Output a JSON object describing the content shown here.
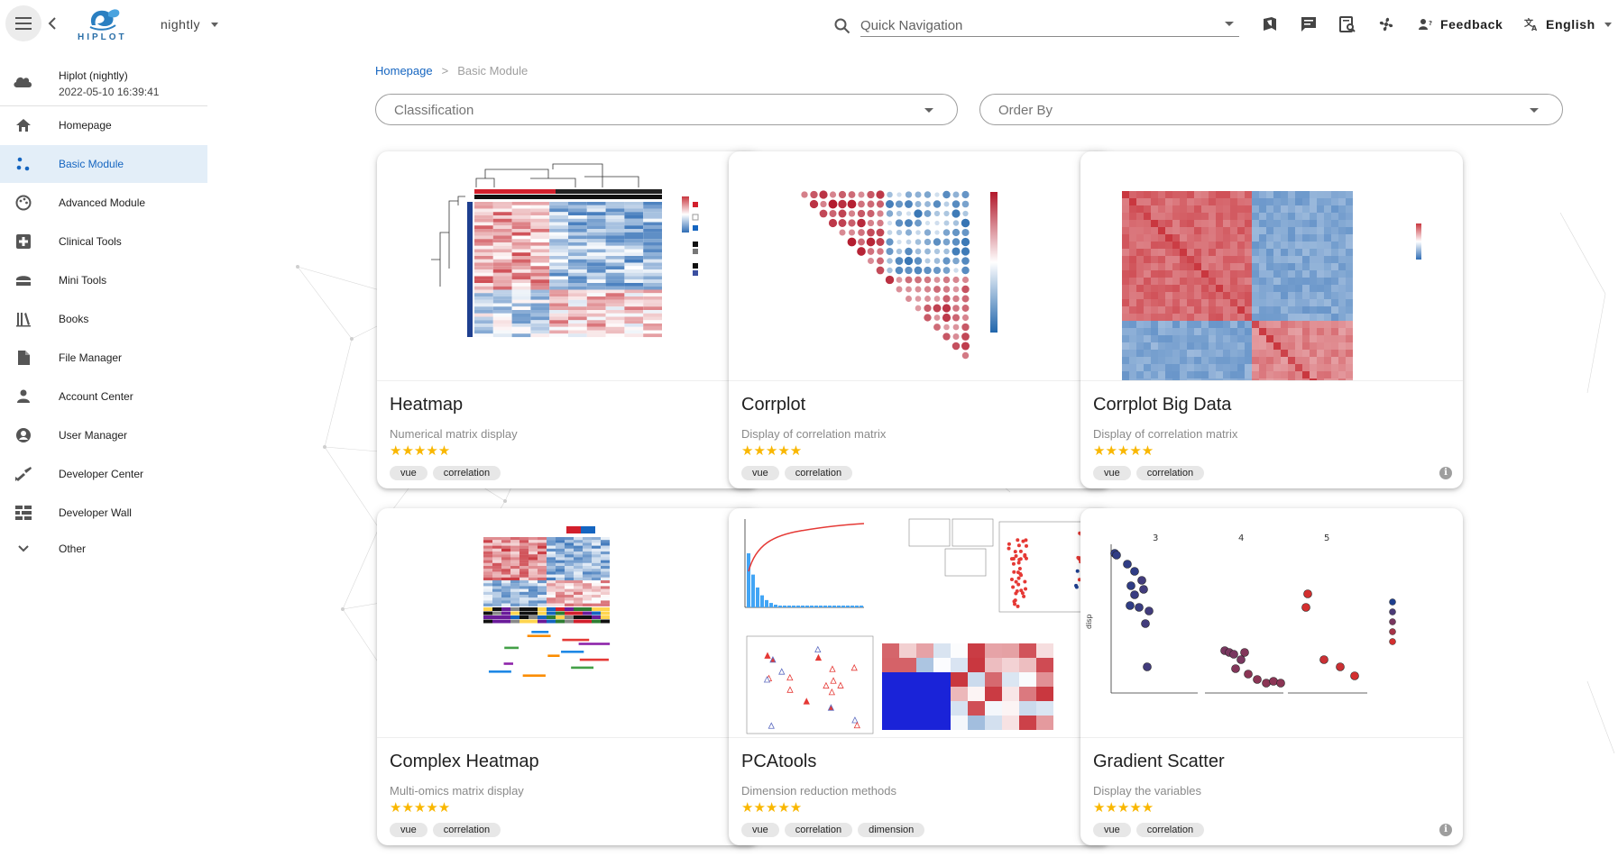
{
  "topbar": {
    "logo_text": "HIPLOT",
    "branch": "nightly",
    "search_placeholder": "Quick Navigation",
    "feedback_label": "Feedback",
    "language_label": "English",
    "icons": [
      "bookmark-icon",
      "chat-icon",
      "doc-search-icon",
      "fan-icon"
    ]
  },
  "sidebar": {
    "status": {
      "name": "Hiplot (nightly)",
      "timestamp": "2022-05-10 16:39:41"
    },
    "items": [
      {
        "label": "Homepage",
        "icon": "home-icon"
      },
      {
        "label": "Basic Module",
        "icon": "scatter-dots-icon",
        "active": true
      },
      {
        "label": "Advanced Module",
        "icon": "palette-icon"
      },
      {
        "label": "Clinical Tools",
        "icon": "medical-cross-icon"
      },
      {
        "label": "Mini Tools",
        "icon": "toolbox-icon"
      },
      {
        "label": "Books",
        "icon": "books-icon"
      },
      {
        "label": "File Manager",
        "icon": "file-icon"
      },
      {
        "label": "Account Center",
        "icon": "person-icon"
      },
      {
        "label": "User Manager",
        "icon": "account-circle-icon"
      },
      {
        "label": "Developer Center",
        "icon": "developer-icon"
      },
      {
        "label": "Developer Wall",
        "icon": "grid-wall-icon"
      },
      {
        "label": "Other",
        "icon": "chevron-down-icon"
      }
    ]
  },
  "breadcrumb": {
    "home": "Homepage",
    "separator": ">",
    "current": "Basic Module"
  },
  "filters": {
    "classification": "Classification",
    "order_by": "Order By"
  },
  "cards": [
    {
      "title": "Heatmap",
      "description": "Numerical matrix display",
      "stars": "★★★★★",
      "tags": [
        "vue",
        "correlation"
      ]
    },
    {
      "title": "Corrplot",
      "description": "Display of correlation matrix",
      "stars": "★★★★★",
      "tags": [
        "vue",
        "correlation"
      ]
    },
    {
      "title": "Corrplot Big Data",
      "description": "Display of correlation matrix",
      "stars": "★★★★★",
      "tags": [
        "vue",
        "correlation"
      ]
    },
    {
      "title": "Complex Heatmap",
      "description": "Multi-omics matrix display",
      "stars": "★★★★★",
      "tags": [
        "vue",
        "correlation"
      ]
    },
    {
      "title": "PCAtools",
      "description": "Dimension reduction methods",
      "stars": "★★★★★",
      "tags": [
        "vue",
        "correlation",
        "dimension"
      ]
    },
    {
      "title": "Gradient Scatter",
      "description": "Display the variables",
      "stars": "★★★★★",
      "tags": [
        "vue",
        "correlation"
      ]
    }
  ],
  "colors": {
    "accent": "#1565c0",
    "active_bg": "#e3eef8",
    "star": "#f9b700",
    "heat_red": "#c9373f",
    "heat_blue": "#2f6db5"
  }
}
